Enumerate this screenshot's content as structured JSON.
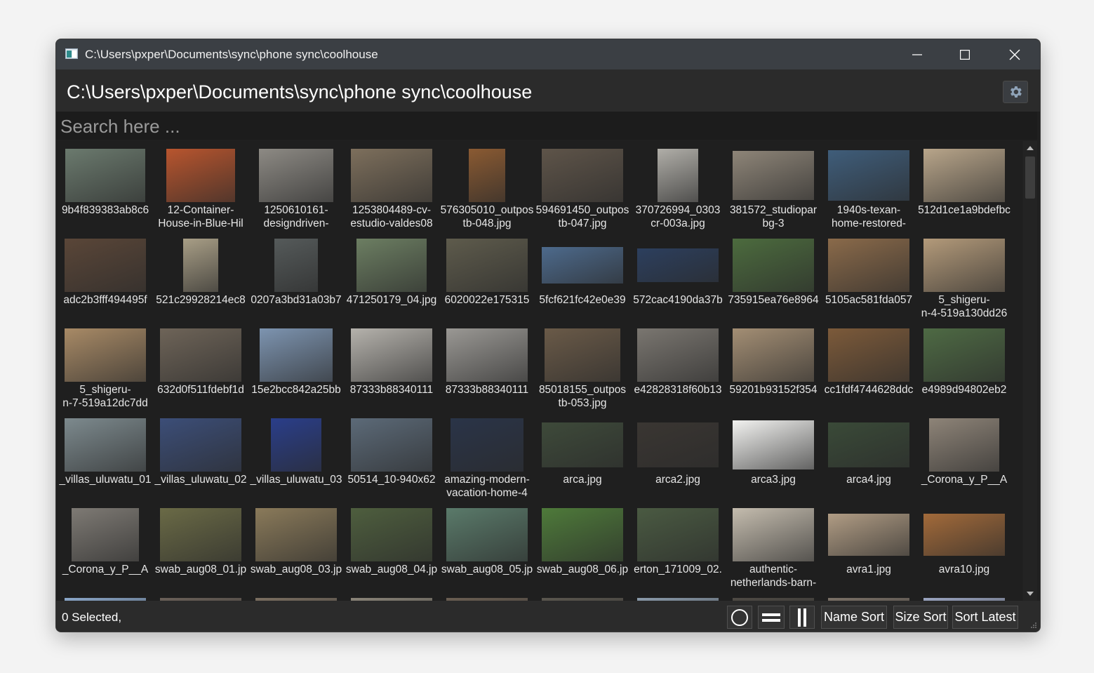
{
  "window": {
    "title": "C:\\Users\\pxper\\Documents\\sync\\phone sync\\coolhouse"
  },
  "header": {
    "path": "C:\\Users\\pxper\\Documents\\sync\\phone sync\\coolhouse"
  },
  "search": {
    "placeholder": "Search here ..."
  },
  "status": {
    "selected_text": "0 Selected,"
  },
  "toolbar": {
    "name_sort": "Name Sort",
    "size_sort": "Size Sort",
    "sort_latest": "Sort Latest"
  },
  "colors": {
    "titlebar": "#3b3f44",
    "background": "#202020",
    "header": "#2b2b2b",
    "text": "#ffffff"
  },
  "thumbnails": [
    {
      "line1": "9b4f839383ab8c6",
      "line2": "",
      "thumb": "#6b7a6e"
    },
    {
      "line1": "12-Container-",
      "line2": "House-in-Blue-Hil",
      "thumb": "#b8552e"
    },
    {
      "line1": "1250610161-",
      "line2": "designdriven-",
      "thumb": "#8d8a84"
    },
    {
      "line1": "1253804489-cv-",
      "line2": "estudio-valdes08",
      "thumb": "#7d6f5c"
    },
    {
      "line1": "576305010_outpos",
      "line2": "tb-048.jpg",
      "thumb": "#8a5a32"
    },
    {
      "line1": "594691450_outpos",
      "line2": "tb-047.jpg",
      "thumb": "#5e5449"
    },
    {
      "line1": "370726994_0303",
      "line2": "cr-003a.jpg",
      "thumb": "#b0aea8"
    },
    {
      "line1": "381572_studiopar",
      "line2": "bg-3",
      "thumb": "#8e8578"
    },
    {
      "line1": "1940s-texan-",
      "line2": "home-restored-",
      "thumb": "#3f5d7a"
    },
    {
      "line1": "512d1ce1a9bdefbc",
      "line2": "",
      "thumb": "#b8a58a"
    },
    {
      "line1": "adc2b3fff494495f",
      "line2": "",
      "thumb": "#5a4638"
    },
    {
      "line1": "521c29928214ec8",
      "line2": "",
      "thumb": "#a89e86"
    },
    {
      "line1": "0207a3bd31a03b7",
      "line2": "",
      "thumb": "#555a5a"
    },
    {
      "line1": "471250179_04.jpg",
      "line2": "",
      "thumb": "#6c7e62"
    },
    {
      "line1": "6020022e175315",
      "line2": "",
      "thumb": "#5e5b4c"
    },
    {
      "line1": "5fcf621fc42e0e39",
      "line2": "",
      "thumb": "#4d6a8c"
    },
    {
      "line1": "572cac4190da37b",
      "line2": "",
      "thumb": "#2c3f5e"
    },
    {
      "line1": "735915ea76e8964",
      "line2": "",
      "thumb": "#4c6b3e"
    },
    {
      "line1": "5105ac581fda057",
      "line2": "",
      "thumb": "#8a6a4a"
    },
    {
      "line1": "5_shigeru-",
      "line2": "n-4-519a130dd26",
      "thumb": "#b39a7a"
    },
    {
      "line1": "5_shigeru-",
      "line2": "n-7-519a12dc7dd",
      "thumb": "#a88a66"
    },
    {
      "line1": "632d0f511fdebf1d",
      "line2": "",
      "thumb": "#6e6458"
    },
    {
      "line1": "15e2bcc842a25bb",
      "line2": "",
      "thumb": "#7d94b0"
    },
    {
      "line1": "87333b88340111",
      "line2": "",
      "thumb": "#b5b2ac"
    },
    {
      "line1": "87333b88340111",
      "line2": "",
      "thumb": "#9a9894"
    },
    {
      "line1": "85018155_outpos",
      "line2": "tb-053.jpg",
      "thumb": "#6a5a48"
    },
    {
      "line1": "e42828318f60b13",
      "line2": "",
      "thumb": "#7a7670"
    },
    {
      "line1": "59201b93152f354",
      "line2": "",
      "thumb": "#a38e74"
    },
    {
      "line1": "cc1fdf4744628ddc",
      "line2": "",
      "thumb": "#7c5a3a"
    },
    {
      "line1": "e4989d94802eb2",
      "line2": "",
      "thumb": "#4e6a44"
    },
    {
      "line1": "_villas_uluwatu_01",
      "line2": "",
      "thumb": "#7d8a8e"
    },
    {
      "line1": "_villas_uluwatu_02",
      "line2": "",
      "thumb": "#3c4e78"
    },
    {
      "line1": "_villas_uluwatu_03",
      "line2": "",
      "thumb": "#2a3e8a"
    },
    {
      "line1": "50514_10-940x62",
      "line2": "",
      "thumb": "#5c6a78"
    },
    {
      "line1": "amazing-modern-",
      "line2": "vacation-home-4",
      "thumb": "#2a3448"
    },
    {
      "line1": "arca.jpg",
      "line2": "",
      "thumb": "#3e4a3a"
    },
    {
      "line1": "arca2.jpg",
      "line2": "",
      "thumb": "#3a3632"
    },
    {
      "line1": "arca3.jpg",
      "line2": "",
      "thumb": "#f2f2f0"
    },
    {
      "line1": "arca4.jpg",
      "line2": "",
      "thumb": "#3a4a38"
    },
    {
      "line1": "_Corona_y_P__A",
      "line2": "",
      "thumb": "#8e8478"
    },
    {
      "line1": "_Corona_y_P__A",
      "line2": "",
      "thumb": "#7e7a74"
    },
    {
      "line1": "swab_aug08_01.jp",
      "line2": "",
      "thumb": "#6a6a46"
    },
    {
      "line1": "swab_aug08_03.jp",
      "line2": "",
      "thumb": "#8a7a5a"
    },
    {
      "line1": "swab_aug08_04.jp",
      "line2": "",
      "thumb": "#4e5e3e"
    },
    {
      "line1": "swab_aug08_05.jp",
      "line2": "",
      "thumb": "#5a7a6a"
    },
    {
      "line1": "swab_aug08_06.jp",
      "line2": "",
      "thumb": "#4e7a3a"
    },
    {
      "line1": "erton_171009_02.",
      "line2": "",
      "thumb": "#4a5a42"
    },
    {
      "line1": "authentic-",
      "line2": "netherlands-barn-",
      "thumb": "#c4bcae"
    },
    {
      "line1": "avra1.jpg",
      "line2": "",
      "thumb": "#b09c84"
    },
    {
      "line1": "avra10.jpg",
      "line2": "",
      "thumb": "#a26a3a"
    },
    {
      "line1": "",
      "line2": "",
      "thumb": "#8aa6c8"
    },
    {
      "line1": "",
      "line2": "",
      "thumb": "#6a6058"
    },
    {
      "line1": "",
      "line2": "",
      "thumb": "#7a6e60"
    },
    {
      "line1": "",
      "line2": "",
      "thumb": "#8a8478"
    },
    {
      "line1": "",
      "line2": "",
      "thumb": "#6a5e52"
    },
    {
      "line1": "",
      "line2": "",
      "thumb": "#5a564e"
    },
    {
      "line1": "",
      "line2": "",
      "thumb": "#8a9aaa"
    },
    {
      "line1": "",
      "line2": "",
      "thumb": "#4e4a44"
    },
    {
      "line1": "",
      "line2": "",
      "thumb": "#7a7066"
    },
    {
      "line1": "",
      "line2": "",
      "thumb": "#9aa4c0"
    }
  ]
}
